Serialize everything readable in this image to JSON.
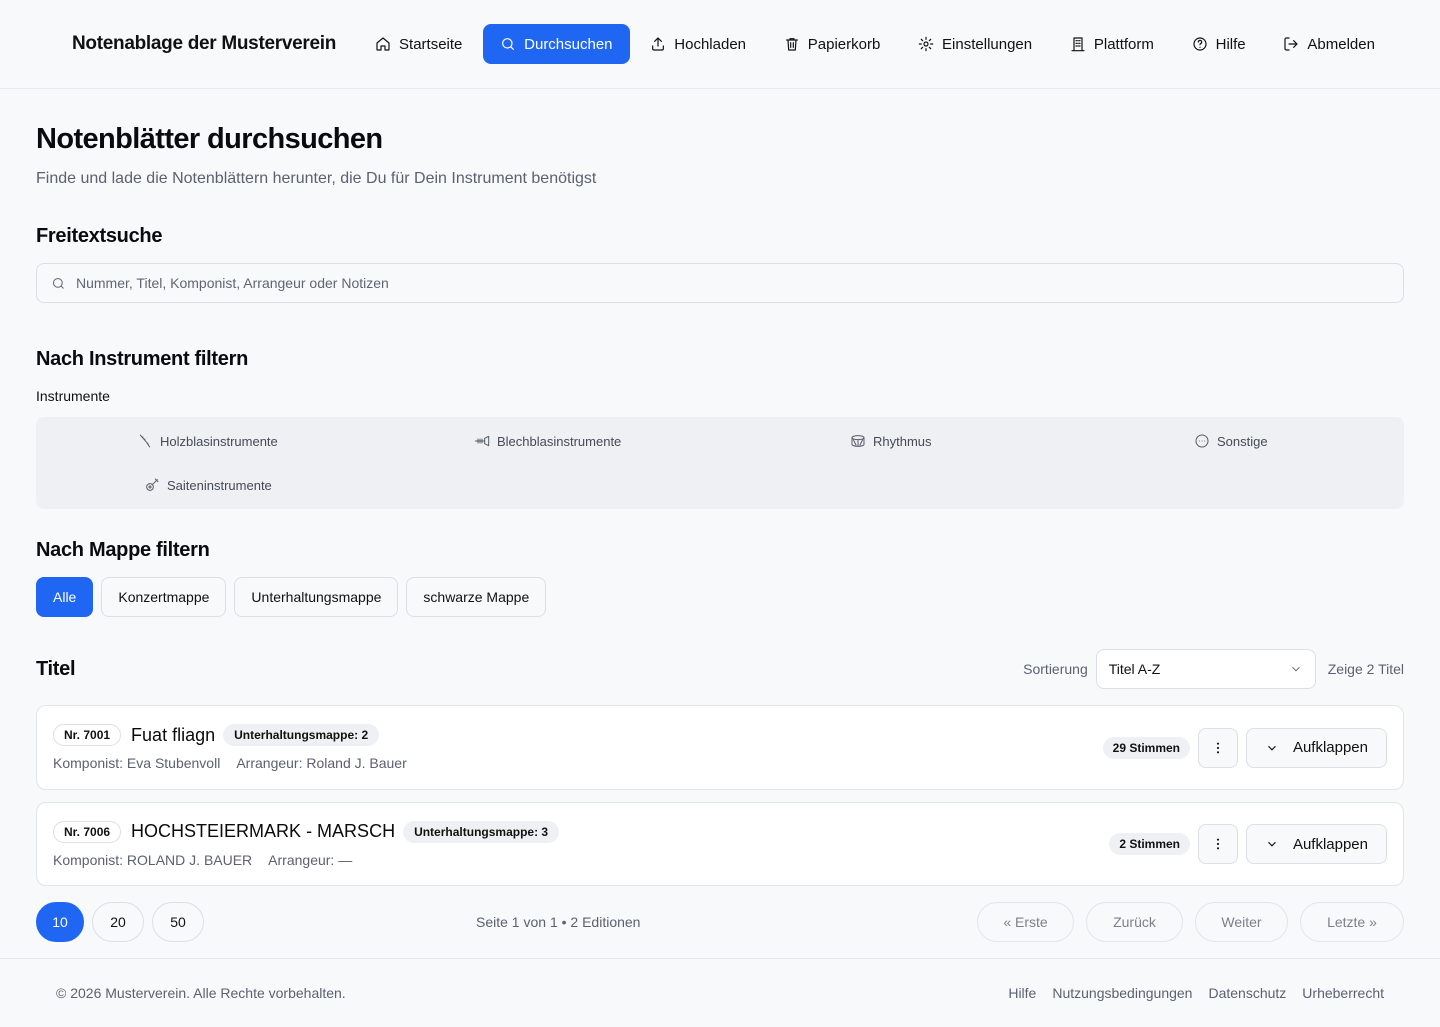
{
  "header": {
    "brand": "Notenablage der Musterverein",
    "nav": [
      {
        "label": "Startseite",
        "icon": "home-icon"
      },
      {
        "label": "Durchsuchen",
        "icon": "search-icon",
        "active": true
      },
      {
        "label": "Hochladen",
        "icon": "upload-icon"
      },
      {
        "label": "Papierkorb",
        "icon": "trash-icon"
      },
      {
        "label": "Einstellungen",
        "icon": "gear-icon"
      },
      {
        "label": "Plattform",
        "icon": "building-icon"
      },
      {
        "label": "Hilfe",
        "icon": "help-circle-icon"
      },
      {
        "label": "Abmelden",
        "icon": "logout-icon"
      }
    ]
  },
  "page": {
    "title": "Notenblätter durchsuchen",
    "subtitle": "Finde und lade die Notenblättern herunter, die Du für Dein Instrument benötigst"
  },
  "freetext": {
    "heading": "Freitextsuche",
    "placeholder": "Nummer, Titel, Komponist, Arrangeur oder Notizen",
    "value": ""
  },
  "instruments": {
    "heading": "Nach Instrument filtern",
    "label": "Instrumente",
    "items": [
      {
        "label": "Holzblasinstrumente",
        "icon": "clarinet-icon"
      },
      {
        "label": "Blechblasinstrumente",
        "icon": "trumpet-icon"
      },
      {
        "label": "Rhythmus",
        "icon": "drum-icon"
      },
      {
        "label": "Sonstige",
        "icon": "more-circle-icon"
      },
      {
        "label": "Saiteninstrumente",
        "icon": "guitar-icon"
      }
    ]
  },
  "folders": {
    "heading": "Nach Mappe filtern",
    "items": [
      "Alle",
      "Konzertmappe",
      "Unterhaltungsmappe",
      "schwarze Mappe"
    ],
    "active": "Alle"
  },
  "titles": {
    "heading": "Titel",
    "sort_label": "Sortierung",
    "sort_value": "Titel A-Z",
    "count_text": "Zeige 2 Titel",
    "expand_label": "Aufklappen",
    "items": [
      {
        "nr": "Nr. 7001",
        "title": "Fuat fliagn",
        "badge": "Unterhaltungsmappe: 2",
        "composer": "Komponist: Eva Stubenvoll",
        "arranger": "Arrangeur: Roland J. Bauer",
        "voices": "29 Stimmen"
      },
      {
        "nr": "Nr. 7006",
        "title": "HOCHSTEIERMARK - MARSCH",
        "badge": "Unterhaltungsmappe: 3",
        "composer": "Komponist: ROLAND J. BAUER",
        "arranger": "Arrangeur: —",
        "voices": "2 Stimmen"
      }
    ]
  },
  "pagination": {
    "sizes": [
      "10",
      "20",
      "50"
    ],
    "active_size": "10",
    "info": "Seite 1 von 1 • 2 Editionen",
    "first": "« Erste",
    "prev": "Zurück",
    "next": "Weiter",
    "last": "Letzte »"
  },
  "footer": {
    "copyright": "© 2026 Musterverein. Alle Rechte vorbehalten.",
    "links": [
      "Hilfe",
      "Nutzungsbedingungen",
      "Datenschutz",
      "Urheberrecht"
    ]
  },
  "colors": {
    "accent": "#1f66f2",
    "background": "#f8f9fb",
    "muted_text": "#5b6170"
  }
}
